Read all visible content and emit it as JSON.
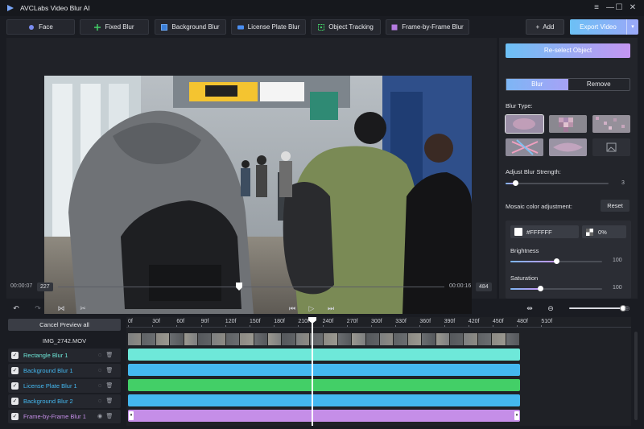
{
  "app": {
    "title": "AVCLabs Video Blur AI"
  },
  "window_controls": {
    "menu": "≡",
    "minimize": "—",
    "maximize": "☐",
    "close": "✕"
  },
  "toolbar": {
    "tools": [
      {
        "label": "Face",
        "icon": "face-icon"
      },
      {
        "label": "Fixed Blur",
        "icon": "fixed-blur-icon"
      },
      {
        "label": "Background Blur",
        "icon": "background-blur-icon"
      },
      {
        "label": "License Plate Blur",
        "icon": "license-plate-icon"
      },
      {
        "label": "Object Tracking",
        "icon": "object-tracking-icon"
      },
      {
        "label": "Frame-by-Frame Blur",
        "icon": "frame-by-frame-icon"
      }
    ],
    "add_label": "Add",
    "add_symbol": "+",
    "export_label": "Export Video",
    "export_caret": "▾"
  },
  "preview": {
    "current_time": "00:00:07",
    "current_frame": "227",
    "total_time": "00:00:16",
    "total_frames": "484",
    "progress_fraction": 0.469
  },
  "panel": {
    "reselect_label": "Re-select Object",
    "tabs": [
      "Blur",
      "Remove"
    ],
    "active_tab": 0,
    "blur_type_label": "Blur Type:",
    "blur_types": [
      "gaussian",
      "mosaic",
      "pixel",
      "color-swirl",
      "glass",
      "image"
    ],
    "selected_blur_type": 0,
    "strength_label": "Adjust Blur Strength:",
    "strength_value": "3",
    "strength_fraction": 0.1,
    "mosaic_label": "Mosaic color adjustment:",
    "reset_label": "Reset",
    "color_hex": "#FFFFFF",
    "opacity_value": "0%",
    "brightness_label": "Brightness",
    "brightness_value": "100",
    "brightness_fraction": 0.5,
    "saturation_label": "Saturation",
    "saturation_value": "100",
    "saturation_fraction": 0.33
  },
  "timeline": {
    "cancel_label": "Cancel Preview all",
    "file_name": "IMG_2742.MOV",
    "ruler": [
      "0f",
      "30f",
      "60f",
      "90f",
      "120f",
      "150f",
      "180f",
      "210f",
      "240f",
      "270f",
      "300f",
      "330f",
      "360f",
      "390f",
      "420f",
      "450f",
      "480f",
      "510f"
    ],
    "tracks": [
      {
        "name": "Rectangle Blur 1",
        "color": "#6ee8d9"
      },
      {
        "name": "Background Blur 1",
        "color": "#44b8f0"
      },
      {
        "name": "License Plate Blur 1",
        "color": "#43cf67"
      },
      {
        "name": "Background Blur 2",
        "color": "#44b8f0"
      },
      {
        "name": "Frame-by-Frame Blur 1",
        "color": "#c58ee8"
      }
    ],
    "checkmark": "✓",
    "handle_symbol": "⏸",
    "zoom_fraction": 1.0
  },
  "colors": {
    "accent_blue": "#6cc0f5",
    "accent_purple": "#c596f2",
    "background": "#1a1c22"
  }
}
